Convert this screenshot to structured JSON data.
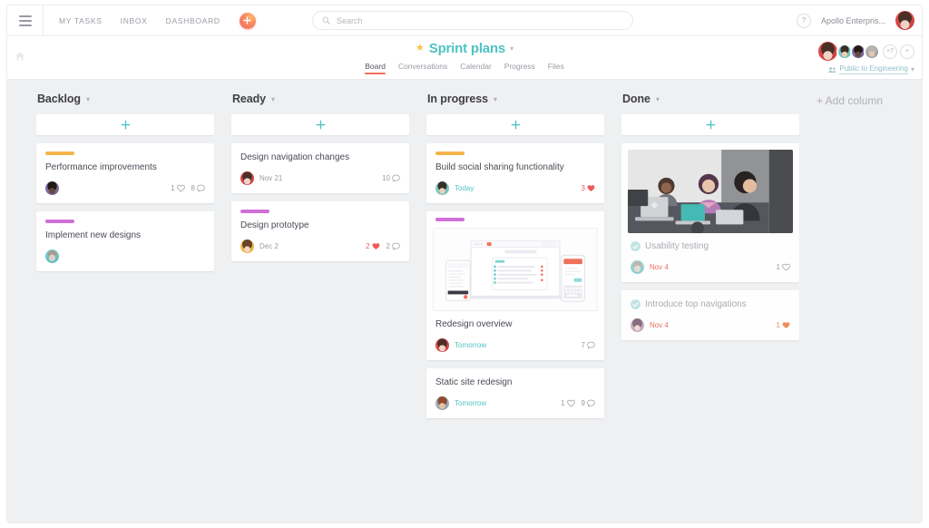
{
  "topbar": {
    "menu_icon": "hamburger-icon",
    "nav": [
      {
        "label": "MY TASKS"
      },
      {
        "label": "INBOX"
      },
      {
        "label": "DASHBOARD"
      }
    ],
    "quick_add_icon": "plus-circle-icon",
    "search": {
      "placeholder": "Search",
      "value": "",
      "icon": "search-icon"
    },
    "help_label": "?",
    "org_name": "Apollo Enterpris...",
    "user_avatar": "woman-red-avatar"
  },
  "project": {
    "star_icon": "star-icon",
    "title": "Sprint plans",
    "title_color": "#4ec3c3",
    "caret_icon": "chevron-down-icon",
    "home_icon": "home-icon",
    "tabs": [
      {
        "label": "Board",
        "active": true
      },
      {
        "label": "Conversations",
        "active": false
      },
      {
        "label": "Calendar",
        "active": false
      },
      {
        "label": "Progress",
        "active": false
      },
      {
        "label": "Files",
        "active": false
      }
    ],
    "members_overflow": "+7",
    "add_member_label": "+",
    "privacy_label": "Public to Engineering",
    "privacy_icon": "people-icon"
  },
  "board": {
    "add_column_label": "+ Add column",
    "add_card_icon": "plus-icon",
    "columns": [
      {
        "title": "Backlog",
        "cards": [
          {
            "title": "Performance improvements",
            "label_color": "#f3b54a",
            "avatar": "av-man-purple",
            "due": "",
            "metrics": [
              {
                "icon": "heart-outline-icon",
                "count": "1",
                "state": "normal"
              },
              {
                "icon": "comment-icon",
                "count": "8",
                "state": "normal"
              }
            ]
          },
          {
            "title": "Implement new designs",
            "label_color": "#cf6fd8",
            "avatar": "av-dog",
            "due": "",
            "metrics": []
          }
        ]
      },
      {
        "title": "Ready",
        "cards": [
          {
            "title": "Design navigation changes",
            "label_color": "",
            "avatar": "av-woman-red",
            "due": "Nov 21",
            "due_state": "normal",
            "metrics": [
              {
                "icon": "comment-icon",
                "count": "10",
                "state": "normal"
              }
            ]
          },
          {
            "title": "Design prototype",
            "label_color": "#cf6fd8",
            "avatar": "av-woman-yellow",
            "due": "Dec 2",
            "due_state": "normal",
            "metrics": [
              {
                "icon": "heart-filled-icon",
                "count": "2",
                "state": "liked"
              },
              {
                "icon": "comment-icon",
                "count": "2",
                "state": "normal"
              }
            ]
          }
        ]
      },
      {
        "title": "In progress",
        "cards": [
          {
            "title": "Build social sharing functionality",
            "label_color": "#f3b54a",
            "avatar": "av-man-teal",
            "due": "Today",
            "due_state": "today",
            "metrics": [
              {
                "icon": "heart-filled-icon",
                "count": "3",
                "state": "liked"
              }
            ]
          },
          {
            "title": "Redesign overview",
            "label_color": "#cf6fd8",
            "thumbnail": "device-mockup-thumbnail",
            "avatar": "av-woman-red",
            "due": "Tomorrow",
            "due_state": "tomorrow",
            "metrics": [
              {
                "icon": "comment-icon",
                "count": "7",
                "state": "normal"
              }
            ]
          },
          {
            "title": "Static site redesign",
            "label_color": "",
            "avatar": "av-person-warm",
            "due": "Tomorrow",
            "due_state": "tomorrow",
            "metrics": [
              {
                "icon": "heart-outline-icon",
                "count": "1",
                "state": "normal"
              },
              {
                "icon": "comment-icon",
                "count": "9",
                "state": "normal"
              }
            ]
          }
        ]
      },
      {
        "title": "Done",
        "cards": [
          {
            "title": "Usability testing",
            "completed": true,
            "thumbnail": "team-photo-thumbnail",
            "avatar": "av-dog",
            "due": "Nov 4",
            "due_state": "overdue",
            "metrics": [
              {
                "icon": "heart-outline-icon",
                "count": "1",
                "state": "normal"
              }
            ]
          },
          {
            "title": "Introduce top navigations",
            "completed": true,
            "avatar": "av-woman-pink",
            "due": "Nov 4",
            "due_state": "overdue",
            "metrics": [
              {
                "icon": "heart-filled-icon",
                "count": "1",
                "state": "liked-warm"
              }
            ]
          }
        ]
      }
    ]
  }
}
